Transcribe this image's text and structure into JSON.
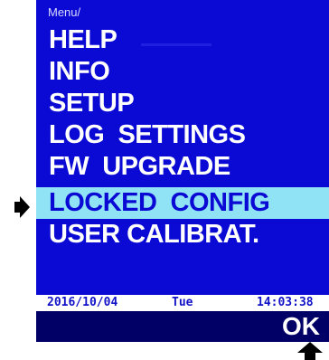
{
  "menu": {
    "title": "Menu/",
    "items": [
      {
        "label": "HELP",
        "selected": false
      },
      {
        "label": "INFO",
        "selected": false
      },
      {
        "label": "SETUP",
        "selected": false
      },
      {
        "label": "LOG  SETTINGS",
        "selected": false
      },
      {
        "label": "FW  UPGRADE",
        "selected": false
      },
      {
        "label": "LOCKED  CONFIG",
        "selected": true
      },
      {
        "label": "USER CALIBRAT.",
        "selected": false
      }
    ]
  },
  "status": {
    "date": "2016/10/04",
    "day": "Tue",
    "time": "14:03:38"
  },
  "softkeys": {
    "right_label": "OK"
  },
  "colors": {
    "screen_bg": "#0a0ad4",
    "selected_bg": "#8fe3f5",
    "softkey_bg": "#000066"
  }
}
